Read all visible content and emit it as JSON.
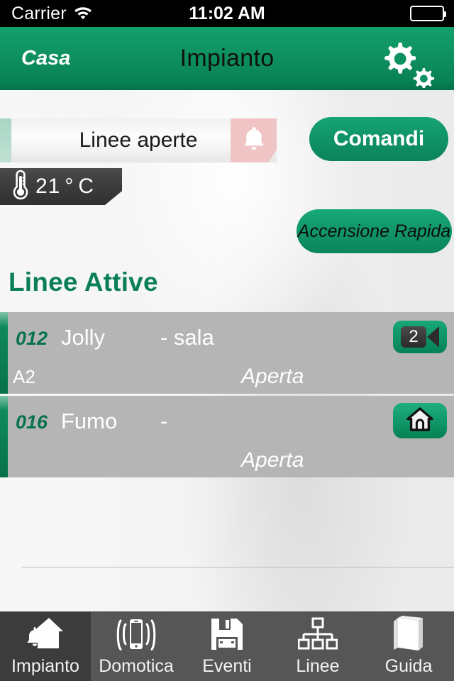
{
  "status_bar": {
    "carrier": "Carrier",
    "wifi_icon": "wifi-icon",
    "time": "11:02 AM",
    "battery_icon": "battery-full-icon"
  },
  "nav_bar": {
    "back_label": "Casa",
    "title": "Impianto",
    "settings_icon": "gears-icon"
  },
  "status_strip": {
    "label": "Linee aperte",
    "alert_icon": "bell-icon",
    "accent_color": "#b3dbcb",
    "alert_bg_color": "#f0c4c4"
  },
  "temperature": {
    "icon": "thermometer-icon",
    "value": "21",
    "degree": "°",
    "unit": "C"
  },
  "actions": {
    "commands_label": "Comandi",
    "quick_arm_label": "Accensione Rapida",
    "accent_color": "#0f9566"
  },
  "section": {
    "title": "Linee Attive"
  },
  "lines": [
    {
      "id": "012",
      "name": "Jolly",
      "zone": "- sala",
      "sub": "A2",
      "state": "Aperta",
      "badge_type": "camera",
      "badge_icon": "video-camera-icon",
      "badge_count": "2"
    },
    {
      "id": "016",
      "name": "Fumo",
      "zone": "-",
      "sub": "",
      "state": "Aperta",
      "badge_type": "home",
      "badge_icon": "home-icon",
      "badge_count": ""
    }
  ],
  "tab_bar": {
    "items": [
      {
        "label": "Impianto",
        "icon": "house-bell-icon",
        "active": true
      },
      {
        "label": "Domotica",
        "icon": "smartphone-signal-icon",
        "active": false
      },
      {
        "label": "Eventi",
        "icon": "floppy-disk-icon",
        "active": false
      },
      {
        "label": "Linee",
        "icon": "org-chart-icon",
        "active": false
      },
      {
        "label": "Guida",
        "icon": "book-icon",
        "active": false
      }
    ]
  }
}
